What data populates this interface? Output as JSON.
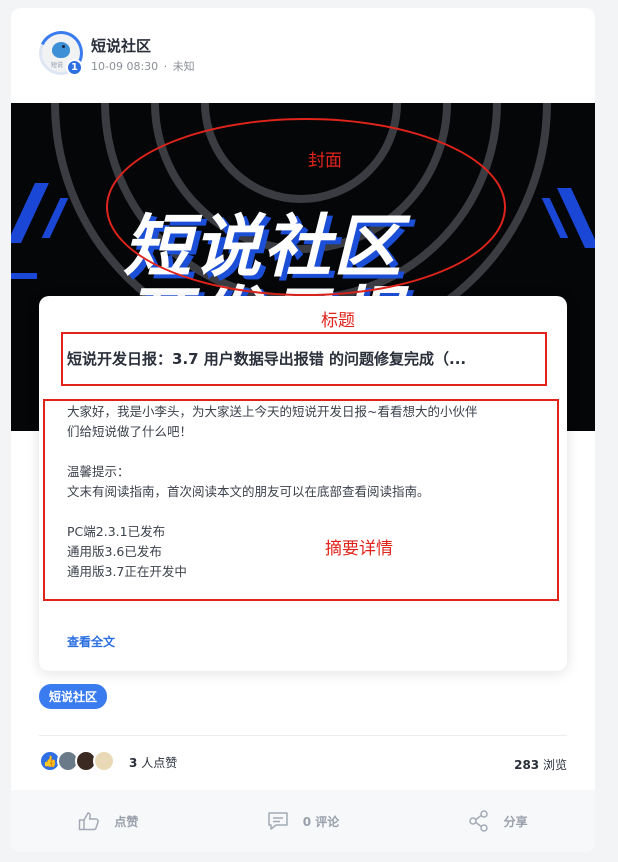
{
  "author": {
    "name": "短说社区",
    "date": "10-09 08:30",
    "separator": "·",
    "status": "未知",
    "avatar_text": "短说",
    "level_badge": "1"
  },
  "cover": {
    "line1": "短说社区",
    "line2": "开发日报"
  },
  "post": {
    "title": "短说开发日报：3.7 用户数据导出报错 的问题修复完成（...",
    "summary_lines": [
      "大家好，我是小李头，为大家送上今天的短说开发日报~看看想大的小伙伴",
      "们给短说做了什么吧！",
      "",
      "温馨提示：",
      "文末有阅读指南，首次阅读本文的朋友可以在底部查看阅读指南。",
      "",
      "PC端2.3.1已发布",
      "通用版3.6已发布",
      "通用版3.7正在开发中"
    ],
    "read_more": "查看全文"
  },
  "annotations": {
    "cover_label": "封面",
    "title_label": "标题",
    "summary_label": "摘要详情",
    "color": "#e0241b"
  },
  "tag": "短说社区",
  "stats": {
    "like_count": "3",
    "like_suffix": "人点赞",
    "view_count": "283",
    "view_suffix": "浏览"
  },
  "actions": {
    "like": "点赞",
    "comment": "0 评论",
    "share": "分享"
  },
  "colors": {
    "accent": "#3a7cf0",
    "annotation": "#e0241b"
  }
}
